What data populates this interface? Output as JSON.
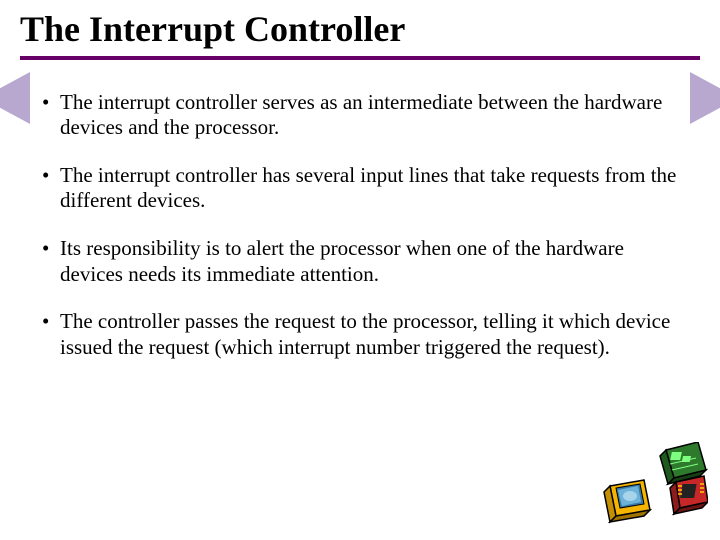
{
  "title": "The Interrupt Controller",
  "bullets": [
    "The interrupt controller serves as an intermediate between the hardware devices and the processor.",
    "The interrupt controller has several input lines that take requests from the different devices.",
    "Its responsibility is to alert the processor when one of the hardware devices needs its immediate attention.",
    "The controller passes the request to the processor, telling it which device issued the request (which interrupt number triggered the request)."
  ],
  "colors": {
    "accent": "#660066",
    "arrow": "#b8a8d0"
  }
}
